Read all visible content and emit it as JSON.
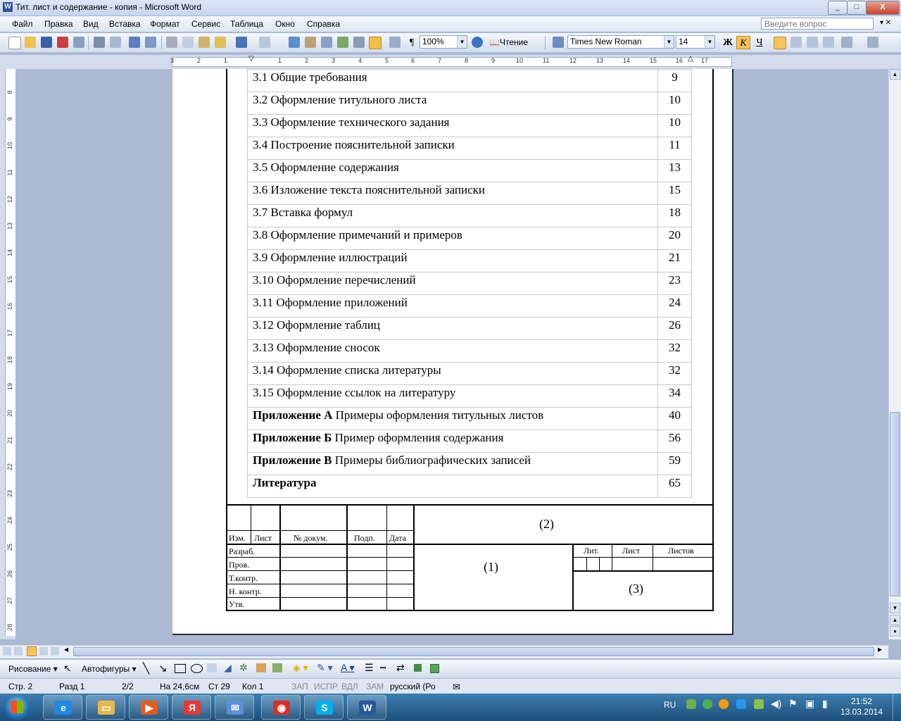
{
  "window": {
    "title": "Тит. лист и содержание - копия - Microsoft Word",
    "app_icon": "W",
    "minimize": "_",
    "maximize": "□",
    "close": "X"
  },
  "menu": {
    "items": [
      "Файл",
      "Правка",
      "Вид",
      "Вставка",
      "Формат",
      "Сервис",
      "Таблица",
      "Окно",
      "Справка"
    ],
    "ask_placeholder": "Введите вопрос"
  },
  "toolbar": {
    "zoom": "100%",
    "reading_label": "Чтение",
    "font_name": "Times New Roman",
    "font_size": "14",
    "bold": "Ж",
    "italic": "К",
    "underline": "Ч",
    "pilcrow": "¶"
  },
  "ruler": {
    "h_numbers": [
      "3",
      "2",
      "1",
      "1",
      "2",
      "3",
      "4",
      "5",
      "6",
      "7",
      "8",
      "9",
      "10",
      "11",
      "12",
      "13",
      "14",
      "15",
      "16",
      "17"
    ],
    "v_numbers": [
      "8",
      "9",
      "10",
      "11",
      "12",
      "13",
      "14",
      "15",
      "16",
      "17",
      "18",
      "19",
      "20",
      "21",
      "22",
      "23",
      "24",
      "25",
      "26",
      "27",
      "28"
    ],
    "tab_selector": "L"
  },
  "toc": [
    {
      "bold": "",
      "text": "3.1 Общие требования",
      "page": "9"
    },
    {
      "bold": "",
      "text": "3.2 Оформление титульного листа",
      "page": "10"
    },
    {
      "bold": "",
      "text": "3.3 Оформление технического задания",
      "page": "10"
    },
    {
      "bold": "",
      "text": "3.4 Построение пояснительной записки",
      "page": "11"
    },
    {
      "bold": "",
      "text": "3.5 Оформление содержания",
      "page": "13"
    },
    {
      "bold": "",
      "text": "3.6 Изложение текста пояснительной записки",
      "page": "15"
    },
    {
      "bold": "",
      "text": "3.7 Вставка формул",
      "page": "18"
    },
    {
      "bold": "",
      "text": "3.8 Оформление примечаний и примеров",
      "page": "20"
    },
    {
      "bold": "",
      "text": "3.9 Оформление иллюстраций",
      "page": "21"
    },
    {
      "bold": "",
      "text": "3.10 Оформление перечислений",
      "page": "23"
    },
    {
      "bold": "",
      "text": "3.11 Оформление приложений",
      "page": "24"
    },
    {
      "bold": "",
      "text": "3.12 Оформление таблиц",
      "page": "26"
    },
    {
      "bold": "",
      "text": "3.13 Оформление сносок",
      "page": "32"
    },
    {
      "bold": "",
      "text": "3.14 Оформление списка литературы",
      "page": "32"
    },
    {
      "bold": "",
      "text": "3.15 Оформление ссылок на литературу",
      "page": "34"
    },
    {
      "bold": "Приложение А",
      "text": " Примеры оформления титульных листов",
      "page": "40"
    },
    {
      "bold": "Приложение Б",
      "text": " Пример оформления содержания",
      "page": "56"
    },
    {
      "bold": "Приложение В",
      "text": " Примеры библиографических записей",
      "page": "59"
    },
    {
      "bold": "Литература",
      "text": "",
      "page": "65"
    }
  ],
  "stamp": {
    "header_cols": [
      "Изм.",
      "Лист",
      "№ докум.",
      "Подп.",
      "Дата"
    ],
    "rows": [
      "Разраб.",
      "Пров.",
      "Т.контр.",
      "Н. контр.",
      "Утв."
    ],
    "field_1": "(1)",
    "field_2": "(2)",
    "field_3": "(3)",
    "lit": "Лит.",
    "sheet": "Лист",
    "sheets": "Листов"
  },
  "drawbar": {
    "drawing": "Рисование",
    "autoshapes": "Автофигуры"
  },
  "status": {
    "page": "Стр. 2",
    "section": "Разд 1",
    "pages": "2/2",
    "at": "На 24,6см",
    "line": "Ст 29",
    "col": "Кол 1",
    "rec": "ЗАП",
    "trk": "ИСПР",
    "ext": "ВДЛ",
    "ovr": "ЗАМ",
    "lang": "русский (Ро"
  },
  "taskbar": {
    "lang": "RU",
    "time": "21:52",
    "date": "13.03.2014",
    "apps": [
      {
        "name": "ie",
        "glyph": "e",
        "color": "#1e88e5"
      },
      {
        "name": "explorer",
        "glyph": "▭",
        "color": "#e8b84a"
      },
      {
        "name": "media",
        "glyph": "▶",
        "color": "#e65c1c"
      },
      {
        "name": "yandex",
        "glyph": "Я",
        "color": "#e53935"
      },
      {
        "name": "mail",
        "glyph": "✉",
        "color": "#5c8fd6"
      },
      {
        "name": "chrome",
        "glyph": "◉",
        "color": "#d93025"
      },
      {
        "name": "skype",
        "glyph": "S",
        "color": "#00aff0"
      },
      {
        "name": "word",
        "glyph": "W",
        "color": "#2b579a"
      }
    ]
  }
}
